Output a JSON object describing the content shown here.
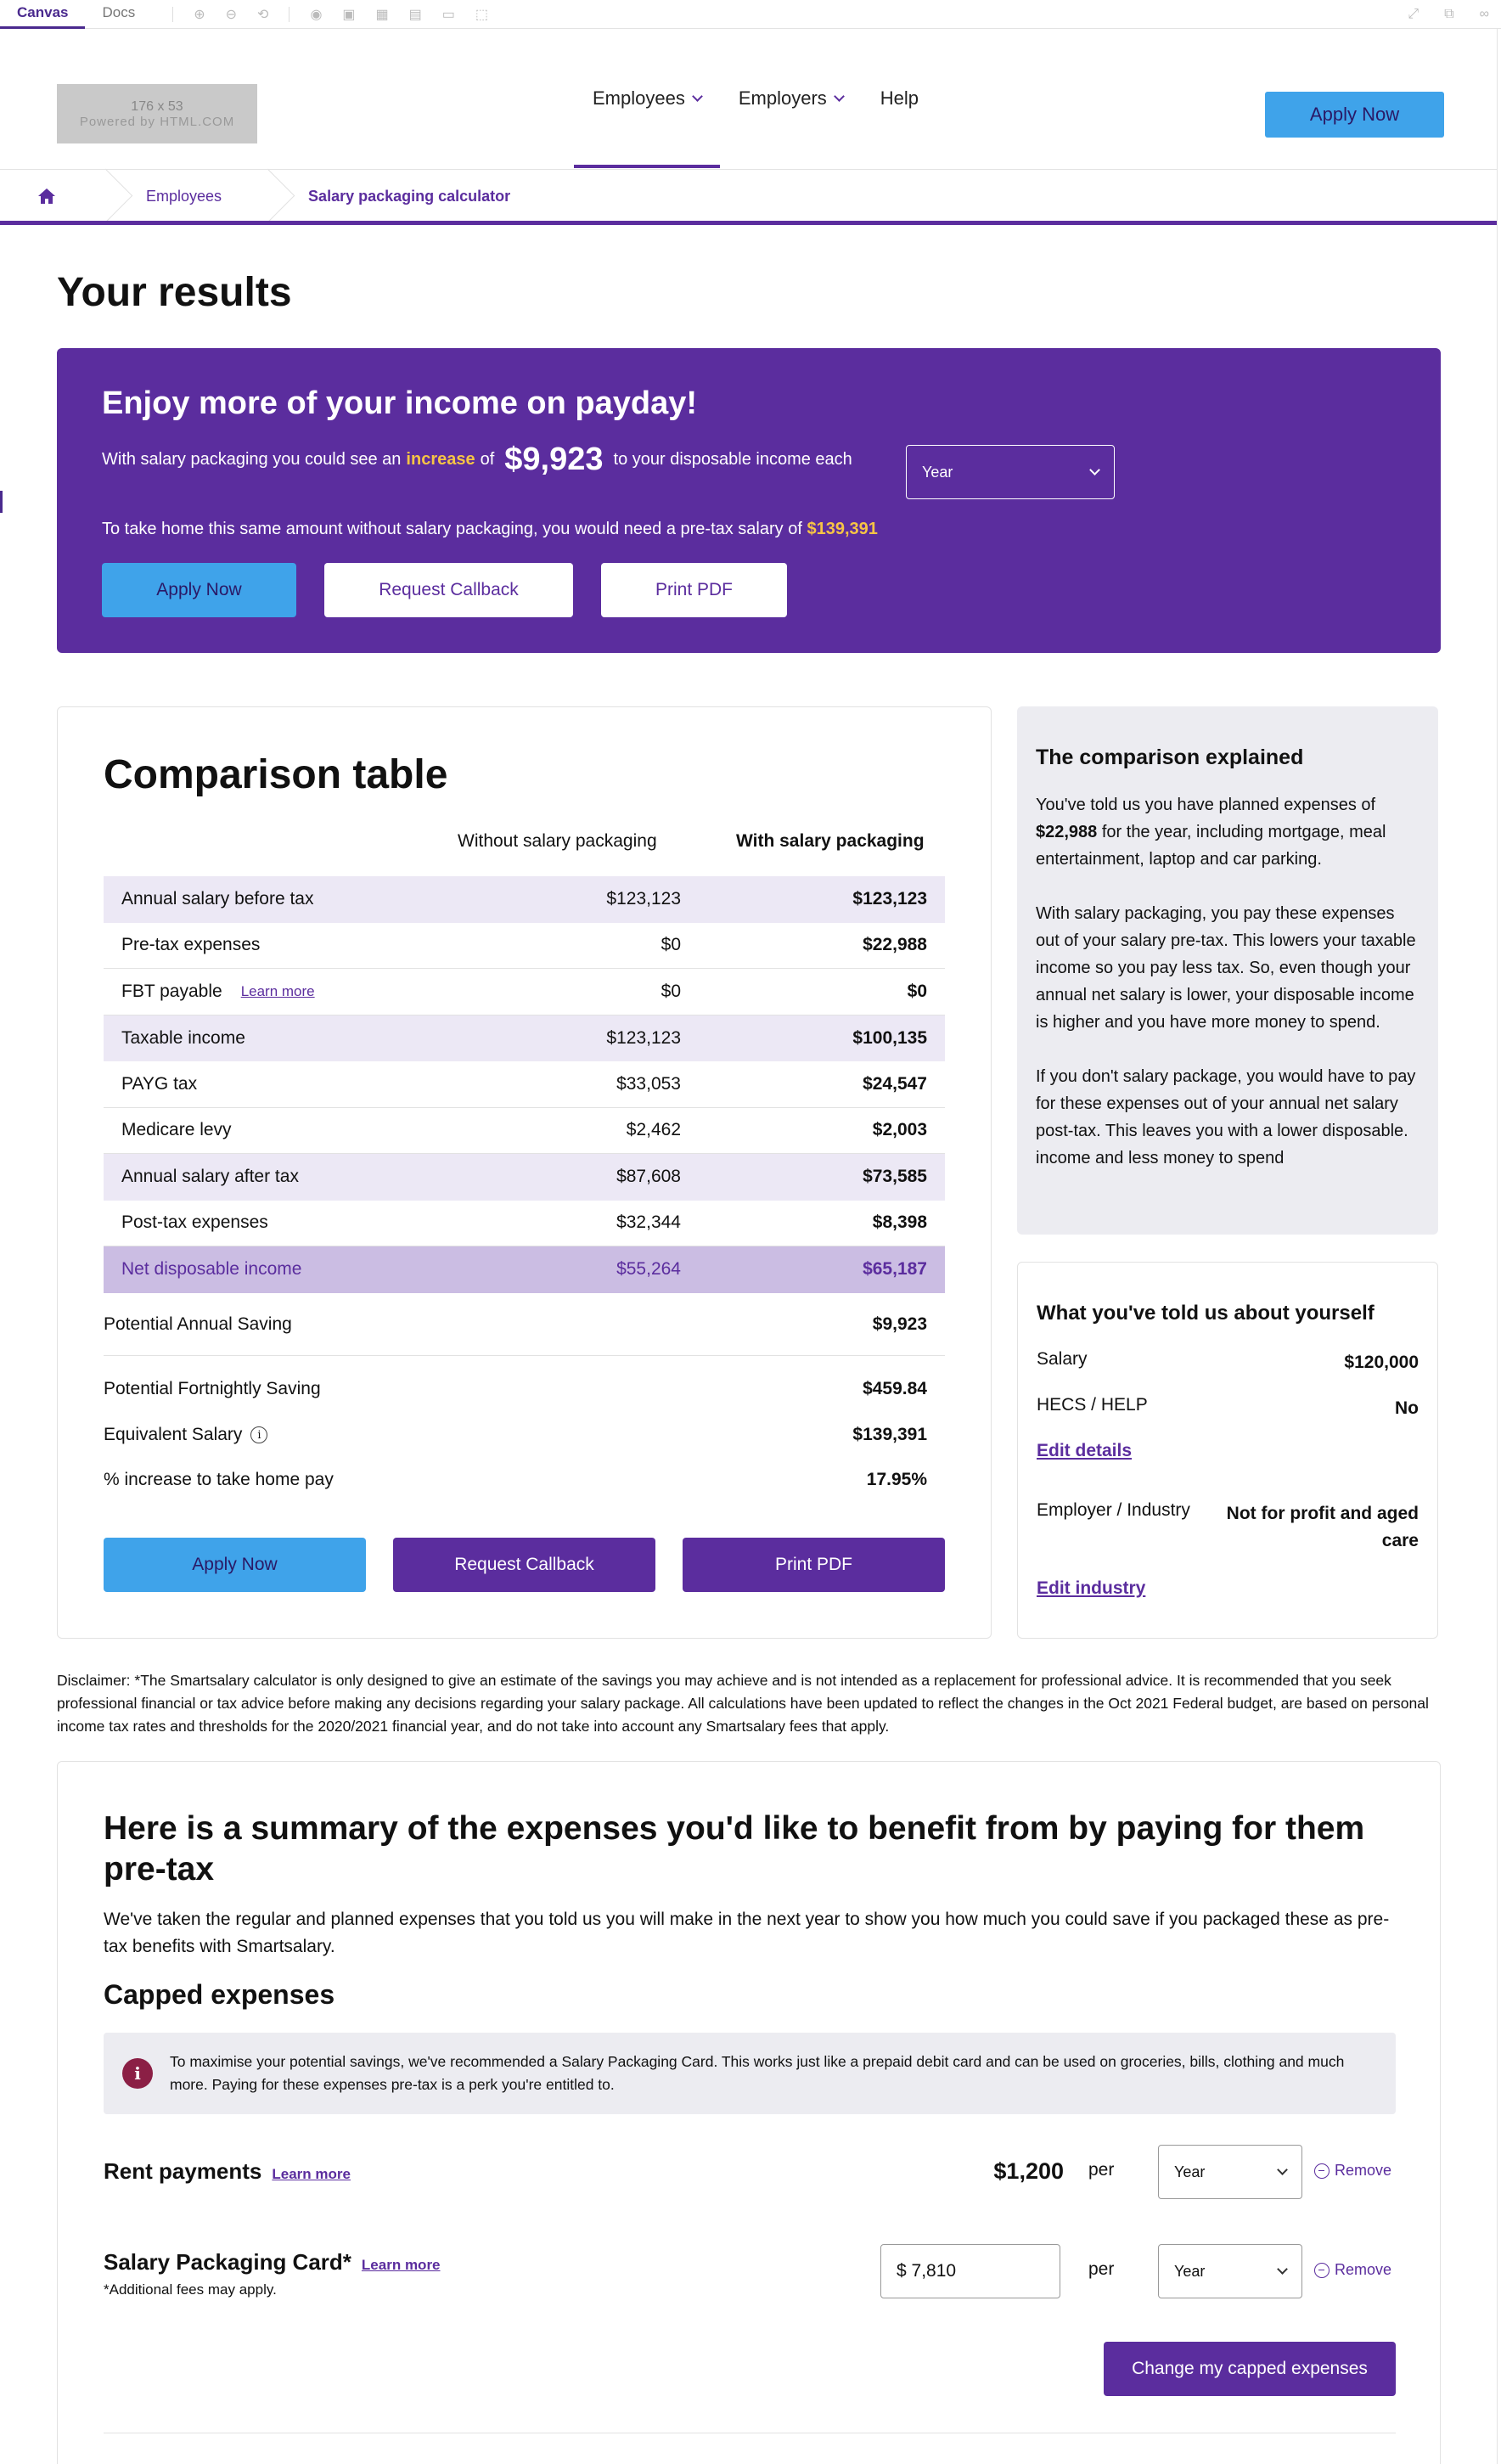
{
  "editor": {
    "tabs": [
      "Canvas",
      "Docs"
    ]
  },
  "header": {
    "logo_dim": "176 x 53",
    "logo_powered": "Powered by HTML.COM",
    "nav": [
      "Employees",
      "Employers",
      "Help"
    ],
    "apply_label": "Apply Now"
  },
  "breadcrumb": [
    "Employees",
    "Salary packaging calculator"
  ],
  "page_title": "Your results",
  "banner": {
    "heading": "Enjoy more of your income on payday!",
    "line1_pre": "With salary packaging you could see an",
    "line1_increase": "increase",
    "line1_of": "of",
    "amount": "$9,923",
    "line1_post": "to your disposable income each",
    "period": "Year",
    "line2_pre": "To take home this same amount without salary packaging, you would need a pre-tax salary of",
    "line2_amount": "$139,391",
    "apply": "Apply Now",
    "callback": "Request Callback",
    "print": "Print PDF"
  },
  "comparison": {
    "title": "Comparison table",
    "col_without": "Without salary packaging",
    "col_with": "With salary packaging",
    "learn_more": "Learn more",
    "rows": [
      {
        "label": "Annual salary before tax",
        "without": "$123,123",
        "with": "$123,123"
      },
      {
        "label": "Pre-tax expenses",
        "without": "$0",
        "with": "$22,988"
      },
      {
        "label": "FBT payable",
        "without": "$0",
        "with": "$0"
      },
      {
        "label": "Taxable income",
        "without": "$123,123",
        "with": "$100,135"
      },
      {
        "label": "PAYG tax",
        "without": "$33,053",
        "with": "$24,547"
      },
      {
        "label": "Medicare levy",
        "without": "$2,462",
        "with": "$2,003"
      },
      {
        "label": "Annual salary after tax",
        "without": "$87,608",
        "with": "$73,585"
      },
      {
        "label": "Post-tax expenses",
        "without": "$32,344",
        "with": "$8,398"
      },
      {
        "label": "Net disposable income",
        "without": "$55,264",
        "with": "$65,187"
      }
    ],
    "savings": [
      {
        "label": "Potential Annual Saving",
        "value": "$9,923"
      },
      {
        "label": "Potential Fortnightly Saving",
        "value": "$459.84"
      },
      {
        "label": "Equivalent Salary",
        "value": "$139,391"
      },
      {
        "label": "% increase to take home pay",
        "value": "17.95%"
      }
    ],
    "apply": "Apply Now",
    "callback": "Request Callback",
    "print": "Print PDF"
  },
  "explained": {
    "title": "The comparison explained",
    "p1_pre": "You've told us you have planned expenses of",
    "p1_amount": "$22,988",
    "p1_post": "for the year, including mortgage, meal entertainment, laptop and car parking.",
    "p2": "With salary packaging, you pay these expenses out of your salary pre-tax. This lowers your taxable income so you pay less tax. So, even though your annual net salary is lower, your disposable income is higher and you have more money to spend.",
    "p3": "If you don't salary package, you would have to pay for these expenses out of your annual net salary post-tax. This leaves you with a lower disposable. income and less money to spend"
  },
  "about": {
    "title": "What you've told us about yourself",
    "salary_label": "Salary",
    "salary_value": "$120,000",
    "hecs_label": "HECS / HELP",
    "hecs_value": "No",
    "edit_details": "Edit details",
    "industry_label": "Employer / Industry",
    "industry_value": "Not for profit and aged care",
    "edit_industry": "Edit industry"
  },
  "disclaimer": "Disclaimer: *The Smartsalary calculator is only designed to give an estimate of the savings you may achieve and is not intended as a replacement for professional advice. It is recommended that you seek professional financial or tax advice before making any decisions regarding your salary package. All calculations have been updated to reflect the changes in the Oct 2021 Federal budget, are based on personal income tax rates and thresholds for the 2020/2021 financial year, and do not take into account any Smartsalary fees that apply.",
  "summary": {
    "title": "Here is a summary of the expenses you'd like to benefit from by paying for them pre-tax",
    "text": "We've taken the regular and planned expenses that you told us you will make in the next year to show you how much you could save if you packaged these as pre-tax benefits with Smartsalary.",
    "capped_title": "Capped expenses",
    "notice": "To maximise your potential savings, we've recommended a Salary Packaging Card. This works just like a prepaid debit card and can be used on groceries, bills, clothing and much more. Paying for these expenses pre-tax is a perk you're entitled to.",
    "rent": {
      "name": "Rent payments",
      "learn": "Learn more",
      "amount": "$1,200",
      "per": "per",
      "period": "Year",
      "remove": "Remove"
    },
    "card": {
      "name": "Salary Packaging Card*",
      "learn": "Learn more",
      "note": "*Additional fees may apply.",
      "amount": "$ 7,810",
      "per": "per",
      "period": "Year",
      "remove": "Remove"
    },
    "change_button": "Change my capped expenses"
  }
}
